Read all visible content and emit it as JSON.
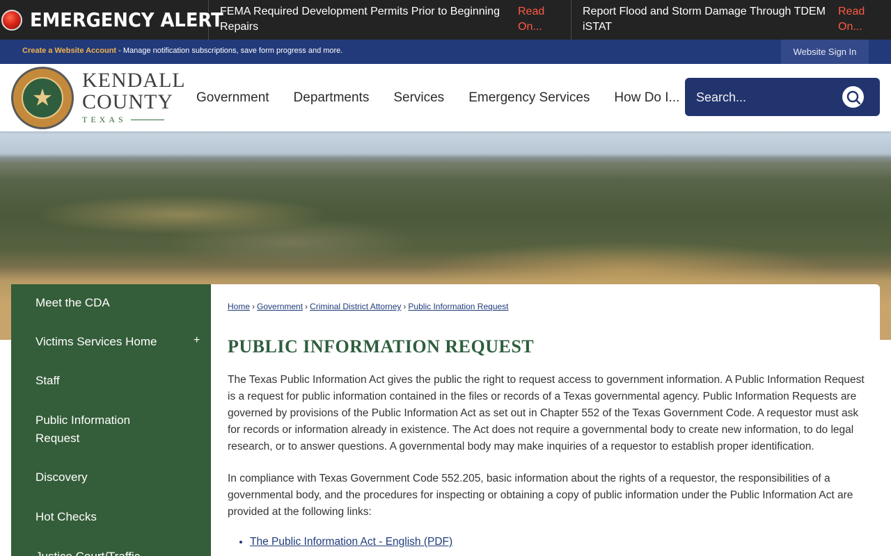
{
  "alert": {
    "title": "EMERGENCY ALERT",
    "items": [
      {
        "text": "FEMA Required Development Permits Prior to Beginning Repairs",
        "link": "Read On..."
      },
      {
        "text": "Report Flood and Storm Damage Through TDEM iSTAT",
        "link": "Read On..."
      }
    ]
  },
  "account": {
    "create_link": "Create a Website Account",
    "description": " - Manage notification subscriptions, save form progress and more.",
    "signin": "Website Sign In"
  },
  "logo": {
    "line1": "KENDALL",
    "line2": "COUNTY",
    "line3": "TEXAS",
    "seal_icon": "county-seal-icon"
  },
  "nav": [
    "Government",
    "Departments",
    "Services",
    "Emergency Services",
    "How Do I..."
  ],
  "search": {
    "placeholder": "Search..."
  },
  "sidebar": {
    "items": [
      {
        "label": "Meet the CDA"
      },
      {
        "label": "Victims Services Home"
      },
      {
        "label": "Staff"
      },
      {
        "label": "Public Information Request"
      },
      {
        "label": "Discovery"
      },
      {
        "label": "Hot Checks"
      },
      {
        "label": "Justice Court/Traffic"
      }
    ],
    "expand_symbol": "+"
  },
  "breadcrumb": [
    "Home",
    "Government",
    "Criminal District Attorney",
    "Public Information Request"
  ],
  "page": {
    "title": "PUBLIC INFORMATION REQUEST",
    "para1": "The Texas Public Information Act gives the public the right to request access to government information. A Public Information Request is a request for public information contained in the files or records of a Texas governmental agency. Public Information Requests are governed by provisions of the Public Information Act as set out in Chapter 552 of the Texas Government Code. A requestor must ask for records or information already in existence. The Act does not require a governmental body to create new information, to do legal research, or to answer questions. A governmental body may make inquiries of a requestor to establish proper identification.",
    "para2": "In compliance with Texas Government Code 552.205, basic information about the rights of a requestor, the responsibilities of a governmental body, and the procedures for inspecting or obtaining a copy of public information under the Public Information Act are provided at the following links:",
    "links": [
      "The Public Information Act - English (PDF)"
    ]
  },
  "colors": {
    "alert_bg": "#232323",
    "account_bar": "#223a7a",
    "search_bg": "#22346e",
    "sidebar_green": "#345d39",
    "title_green": "#2f5e3e",
    "read_on_red": "#ff5a45"
  }
}
